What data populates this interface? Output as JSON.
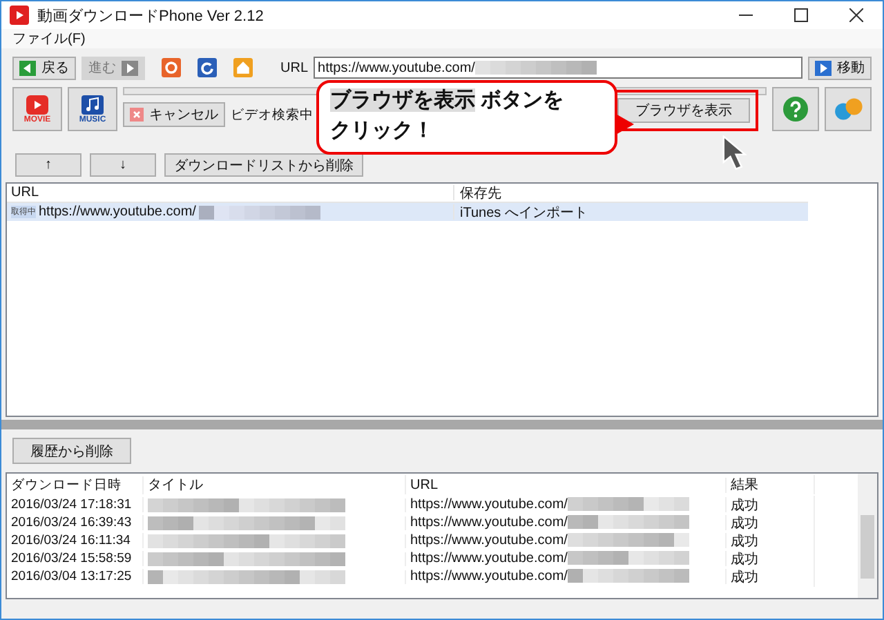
{
  "window": {
    "title": "動画ダウンロードPhone Ver 2.12"
  },
  "menu": [
    "ファイル(F)"
  ],
  "nav": [
    {
      "label": "戻る",
      "kind": "back",
      "disabled": false
    },
    {
      "label": "進む",
      "kind": "forward",
      "disabled": true
    }
  ],
  "url_bar": {
    "label": "URL",
    "value": "https://www.youtube.com/",
    "go": "移動"
  },
  "modes": [
    {
      "label": "MOVIE",
      "kind": "movie"
    },
    {
      "label": "MUSIC",
      "kind": "music"
    }
  ],
  "progress": {
    "level": 0
  },
  "cancel": "キャンセル",
  "status": "ビデオ検索中",
  "browser_button": "ブラウザを表示",
  "callout": {
    "highlight": "ブラウザを表示",
    "text": " ボタンを",
    "line2": "クリック！"
  },
  "list_buttons": [
    "↑",
    "↓",
    "ダウンロードリストから削除"
  ],
  "queue": {
    "columns": [
      "URL",
      "保存先"
    ],
    "rows": [
      {
        "badge": "取得中",
        "url": "https://www.youtube.com/",
        "dest": "iTunes へインポート",
        "selected": true
      }
    ]
  },
  "history_button": "履歴から削除",
  "history": {
    "columns": [
      "ダウンロード日時",
      "タイトル",
      "URL",
      "結果"
    ],
    "rows": [
      {
        "date": "2016/03/24 17:18:31",
        "url": "https://www.youtube.com/",
        "result": "成功"
      },
      {
        "date": "2016/03/24 16:39:43",
        "url": "https://www.youtube.com/",
        "result": "成功"
      },
      {
        "date": "2016/03/24 16:11:34",
        "url": "https://www.youtube.com/",
        "result": "成功"
      },
      {
        "date": "2016/03/24 15:58:59",
        "url": "https://www.youtube.com/",
        "result": "成功"
      },
      {
        "date": "2016/03/04 13:17:25",
        "url": "https://www.youtube.com/",
        "result": "成功"
      }
    ]
  }
}
